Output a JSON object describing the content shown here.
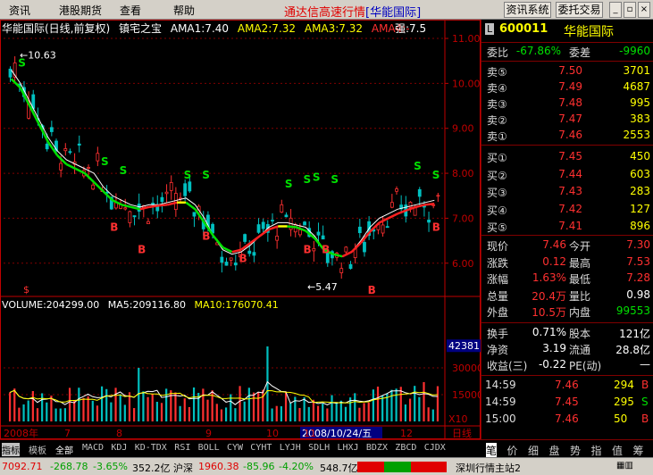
{
  "menubar": {
    "items": [
      "资讯",
      "港股期货",
      "查看",
      "帮助"
    ],
    "app_title": "通达信高速行情",
    "app_stock": "[华能国际]",
    "buttons": [
      "资讯系统",
      "委托交易"
    ]
  },
  "chart_header": {
    "name": "华能国际(日线,前复权)",
    "indicator": "镇宅之宝",
    "ama1": "AMA1:7.40",
    "ama2": "AMA2:7.32",
    "ama3": "AMA3:7.32",
    "ama4": "AMA4:-",
    "strength": "强:7.5"
  },
  "vol_header": {
    "volume": "VOLUME:204299.00",
    "ma5": "MA5:209116.80",
    "ma10": "MA10:176070.41"
  },
  "annotations": {
    "high": "10.63",
    "low": "5.47",
    "s3": "$"
  },
  "colors": {
    "up": "#ff3030",
    "down": "#00c0c0",
    "ama_green": "#00e000",
    "ama_yellow": "#ffff00",
    "ama_red": "#ff2020",
    "grid": "#800000",
    "axis": "#c00000"
  },
  "chart_data": {
    "type": "line",
    "title": "华能国际(日线,前复权)",
    "price_axis": [
      "11.00",
      "10.00",
      "9.00",
      "8.00",
      "7.00",
      "6.00"
    ],
    "price_range": [
      5.3,
      11.1
    ],
    "volume_axis": [
      "42381",
      "30000",
      "15000",
      "X10"
    ],
    "volume_unit": "X10",
    "volume_range": [
      0,
      60000
    ],
    "date_labels": [
      "2008年",
      "7",
      "8",
      "9",
      "10",
      "2008/10/24/五",
      "11",
      "12",
      "日线"
    ],
    "series": [
      {
        "name": "AMA1",
        "values": [
          10.3,
          10.0,
          9.6,
          9.2,
          8.8,
          8.5,
          8.3,
          8.2,
          8.1,
          8.0,
          7.7,
          7.5,
          7.4,
          7.3,
          7.25,
          7.3,
          7.3,
          7.35,
          7.4,
          7.45,
          7.3,
          7.0,
          6.6,
          6.3,
          6.2,
          6.25,
          6.4,
          6.6,
          6.8,
          6.9,
          6.9,
          6.85,
          6.8,
          6.6,
          6.3,
          6.2,
          6.15,
          6.25,
          6.5,
          6.8,
          7.0,
          7.1,
          7.2,
          7.25,
          7.3,
          7.35,
          7.4
        ]
      },
      {
        "name": "AMA2",
        "values": [
          10.1,
          9.9,
          9.5,
          9.1,
          8.7,
          8.4,
          8.2,
          8.1,
          8.0,
          7.8,
          7.6,
          7.4,
          7.3,
          7.25,
          7.2,
          7.25,
          7.28,
          7.3,
          7.35,
          7.35,
          7.2,
          6.9,
          6.6,
          6.35,
          6.25,
          6.3,
          6.45,
          6.6,
          6.75,
          6.82,
          6.82,
          6.8,
          6.72,
          6.55,
          6.3,
          6.2,
          6.15,
          6.25,
          6.45,
          6.7,
          6.9,
          7.0,
          7.1,
          7.18,
          7.25,
          7.3,
          7.32
        ]
      }
    ],
    "trade_signals": [
      {
        "label": "S",
        "x": 1,
        "price": 10.3
      },
      {
        "label": "S",
        "x": 10,
        "price": 8.1
      },
      {
        "label": "B",
        "x": 11,
        "price": 7.0
      },
      {
        "label": "S",
        "x": 12,
        "price": 7.9
      },
      {
        "label": "B",
        "x": 14,
        "price": 6.5
      },
      {
        "label": "S",
        "x": 19,
        "price": 7.8
      },
      {
        "label": "S",
        "x": 21,
        "price": 7.8
      },
      {
        "label": "B",
        "x": 21,
        "price": 6.8
      },
      {
        "label": "B",
        "x": 25,
        "price": 6.3
      },
      {
        "label": "S",
        "x": 30,
        "price": 7.6
      },
      {
        "label": "S",
        "x": 32,
        "price": 7.7
      },
      {
        "label": "S",
        "x": 33,
        "price": 7.75
      },
      {
        "label": "S",
        "x": 35,
        "price": 7.7
      },
      {
        "label": "B",
        "x": 32,
        "price": 6.5
      },
      {
        "label": "B",
        "x": 34,
        "price": 6.5
      },
      {
        "label": "B",
        "x": 39,
        "price": 5.6
      },
      {
        "label": "S",
        "x": 44,
        "price": 8.0
      },
      {
        "label": "S",
        "x": 46,
        "price": 7.8
      },
      {
        "label": "B",
        "x": 46,
        "price": 7.0
      }
    ]
  },
  "quote": {
    "code": "600011",
    "name": "华能国际",
    "weibi_label": "委比",
    "weibi": "-67.86%",
    "weicha_label": "委差",
    "weicha": "-9960",
    "sells": [
      {
        "label": "卖⑤",
        "price": "7.50",
        "vol": "3701"
      },
      {
        "label": "卖④",
        "price": "7.49",
        "vol": "4687"
      },
      {
        "label": "卖③",
        "price": "7.48",
        "vol": "995"
      },
      {
        "label": "卖②",
        "price": "7.47",
        "vol": "383"
      },
      {
        "label": "卖①",
        "price": "7.46",
        "vol": "2553"
      }
    ],
    "buys": [
      {
        "label": "买①",
        "price": "7.45",
        "vol": "450"
      },
      {
        "label": "买②",
        "price": "7.44",
        "vol": "603"
      },
      {
        "label": "买③",
        "price": "7.43",
        "vol": "283"
      },
      {
        "label": "买④",
        "price": "7.42",
        "vol": "127"
      },
      {
        "label": "买⑤",
        "price": "7.41",
        "vol": "896"
      }
    ],
    "stats": [
      {
        "l1": "现价",
        "v1": "7.46",
        "l2": "今开",
        "v2": "7.30"
      },
      {
        "l1": "涨跌",
        "v1": "0.12",
        "l2": "最高",
        "v2": "7.53"
      },
      {
        "l1": "涨幅",
        "v1": "1.63%",
        "l2": "最低",
        "v2": "7.28"
      },
      {
        "l1": "总量",
        "v1": "20.4万",
        "l2": "量比",
        "v2": "0.98"
      },
      {
        "l1": "外盘",
        "v1": "10.5万",
        "l2": "内盘",
        "v2": "99553"
      }
    ],
    "stats2": [
      {
        "l1": "换手",
        "v1": "0.71%",
        "l2": "股本",
        "v2": "121亿"
      },
      {
        "l1": "净资",
        "v1": "3.19",
        "l2": "流通",
        "v2": "28.8亿"
      },
      {
        "l1": "收益(三)",
        "v1": "-0.22",
        "l2": "PE(动)",
        "v2": "—"
      }
    ],
    "ticks": [
      {
        "time": "14:59",
        "price": "7.46",
        "vol": "294",
        "dir": "B"
      },
      {
        "time": "14:59",
        "price": "7.45",
        "vol": "295",
        "dir": "S"
      },
      {
        "time": "15:00",
        "price": "7.46",
        "vol": "50",
        "dir": "B"
      }
    ]
  },
  "indicator_bar": [
    "指标",
    "模板",
    "全部",
    "MACD",
    "KDJ",
    "KD-TDX",
    "RSI",
    "BOLL",
    "CYW",
    "CYHT",
    "LYJH",
    "SDLH",
    "LHXJ",
    "BDZX",
    "ZBCD",
    "CJDX"
  ],
  "quote_tabs": [
    "笔",
    "价",
    "细",
    "盘",
    "势",
    "指",
    "值",
    "筹"
  ],
  "statusbar": {
    "sh_index": "7092.71",
    "sh_change": "-268.78",
    "sh_pct": "-3.65%",
    "sh_amount": "352.2亿",
    "sz_label": "沪深",
    "sz_index": "1960.38",
    "sz_change": "-85.96",
    "sz_pct": "-4.20%",
    "sz_amount": "548.7亿",
    "server": "深圳行情主站2"
  }
}
